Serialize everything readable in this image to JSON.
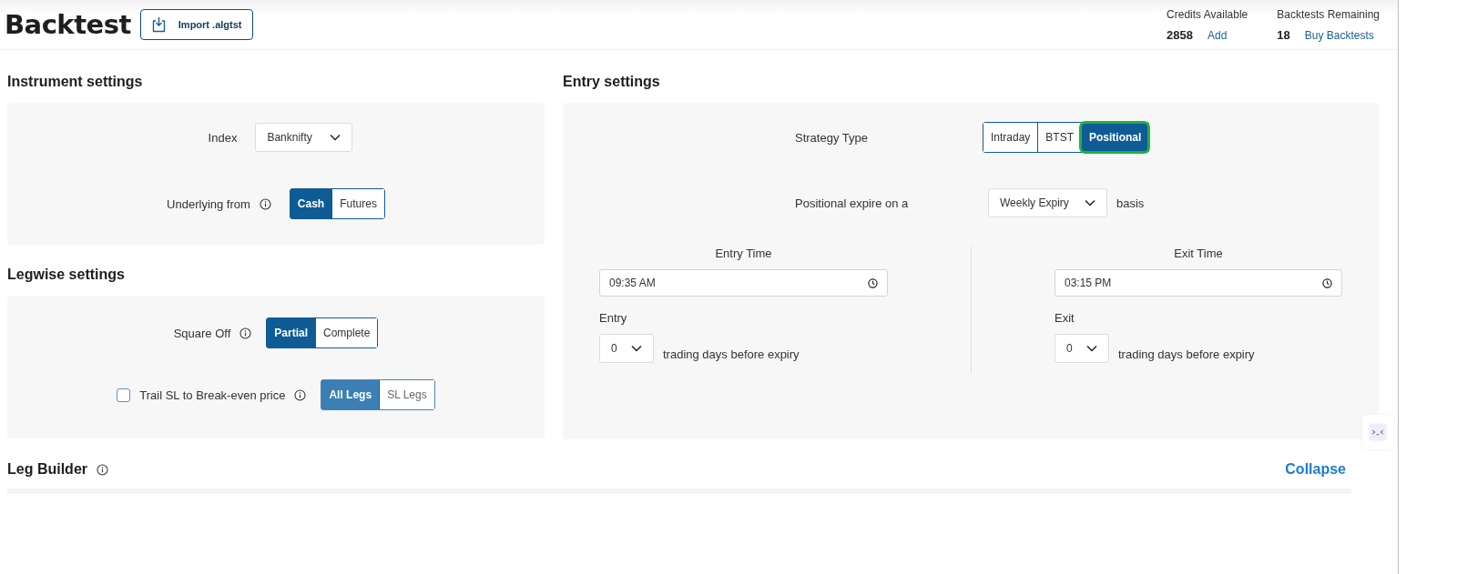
{
  "header": {
    "title": "Backtest",
    "import_button": "Import .algtst",
    "stats": [
      {
        "label": "Credits Available",
        "value": "2858",
        "link": "Add"
      },
      {
        "label": "Backtests Remaining",
        "value": "18",
        "link": "Buy Backtests"
      }
    ]
  },
  "instrument_settings": {
    "title": "Instrument settings",
    "index": {
      "label": "Index",
      "value": "Banknifty"
    },
    "underlying": {
      "label": "Underlying from",
      "options": [
        {
          "label": "Cash",
          "selected": true
        },
        {
          "label": "Futures",
          "selected": false
        }
      ]
    }
  },
  "legwise_settings": {
    "title": "Legwise settings",
    "square_off": {
      "label": "Square Off",
      "options": [
        {
          "label": "Partial",
          "selected": true
        },
        {
          "label": "Complete",
          "selected": false
        }
      ]
    },
    "trail_sl": {
      "label": "Trail SL to Break-even price",
      "checked": false,
      "options": [
        {
          "label": "All Legs",
          "selected": true
        },
        {
          "label": "SL Legs",
          "selected": false
        }
      ]
    }
  },
  "entry_settings": {
    "title": "Entry settings",
    "strategy_type": {
      "label": "Strategy Type",
      "options": [
        {
          "label": "Intraday",
          "selected": false,
          "focused": false
        },
        {
          "label": "BTST",
          "selected": false,
          "focused": false
        },
        {
          "label": "Positional",
          "selected": true,
          "focused": true
        }
      ]
    },
    "expiry": {
      "label": "Positional expire on a",
      "value": "Weekly Expiry",
      "suffix": "basis"
    },
    "times": [
      {
        "title": "Entry Time",
        "time": "09:35 AM",
        "days_label": "Entry",
        "days": "0",
        "days_suffix": "trading days before expiry"
      },
      {
        "title": "Exit Time",
        "time": "03:15 PM",
        "days_label": "Exit",
        "days": "0",
        "days_suffix": "trading days before expiry"
      }
    ]
  },
  "leg_builder": {
    "title": "Leg Builder",
    "collapse": "Collapse"
  }
}
